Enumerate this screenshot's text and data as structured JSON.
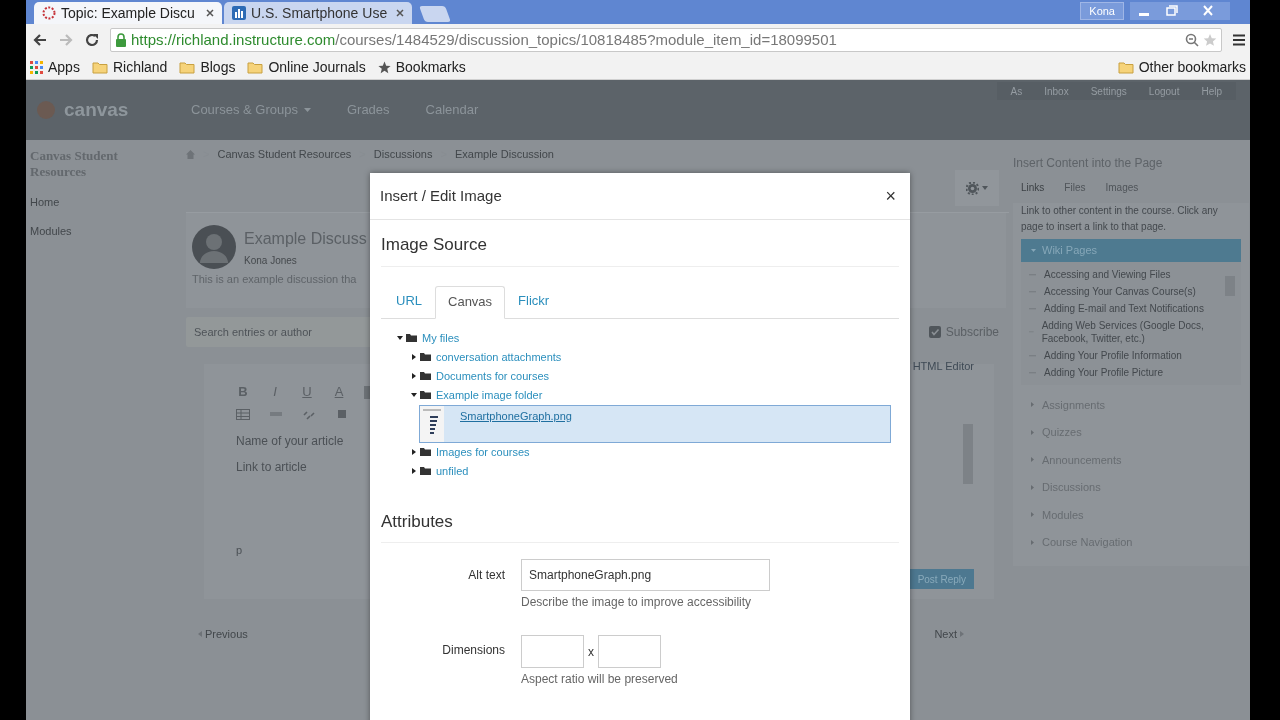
{
  "browser": {
    "tabs": [
      {
        "title": "Topic: Example Discu",
        "selected": true,
        "kind": "canvas"
      },
      {
        "title": "U.S. Smartphone Use",
        "selected": false,
        "kind": "chart"
      }
    ],
    "profile": "Kona",
    "url": {
      "host": "https://richland.instructure.com",
      "path": "/courses/1484529/discussion_topics/10818485?module_item_id=18099501"
    },
    "bookmarks": [
      {
        "label": "Apps",
        "kind": "apps"
      },
      {
        "label": "Richland",
        "kind": "folder"
      },
      {
        "label": "Blogs",
        "kind": "folder"
      },
      {
        "label": "Online Journals",
        "kind": "folder"
      },
      {
        "label": "Bookmarks",
        "kind": "star"
      }
    ],
    "other_bookmarks": "Other bookmarks"
  },
  "header": {
    "logo": "canvas",
    "nav": [
      "Courses & Groups",
      "Grades",
      "Calendar"
    ],
    "user_links": [
      "As",
      "Inbox",
      "Settings",
      "Logout",
      "Help"
    ]
  },
  "left_nav": {
    "course": "Canvas Student Resources",
    "items": [
      "Home",
      "Modules"
    ]
  },
  "breadcrumbs": [
    "Canvas Student Resources",
    "Discussions",
    "Example Discussion"
  ],
  "discussion": {
    "title": "Example Discuss",
    "author": "Kona Jones",
    "body": "This is an example discussion tha",
    "search_placeholder": "Search entries or author",
    "subscribe": "Subscribe",
    "html_editor": "HTML Editor",
    "editor_buttons": [
      "B",
      "I",
      "U",
      "A"
    ],
    "editor_lines": [
      "Name of your article",
      "Link to article"
    ],
    "editor_path": "p",
    "post_reply": "Post Reply",
    "previous": "Previous",
    "next": "Next"
  },
  "right_sidebar": {
    "title": "Insert Content into the Page",
    "tabs": [
      {
        "label": "Links",
        "selected": true
      },
      {
        "label": "Files",
        "selected": false
      },
      {
        "label": "Images",
        "selected": false
      }
    ],
    "hint": "Link to other content in the course. Click any page to insert a link to that page.",
    "sections": [
      {
        "label": "Wiki Pages",
        "expanded": true,
        "items": [
          "Accessing and Viewing Files",
          "Accessing Your Canvas Course(s)",
          "Adding E-mail and Text Notifications",
          "Adding Web Services (Google Docs, Facebook, Twitter, etc.)",
          "Adding Your Profile Information",
          "Adding Your Profile Picture"
        ]
      },
      {
        "label": "Assignments",
        "expanded": false
      },
      {
        "label": "Quizzes",
        "expanded": false
      },
      {
        "label": "Announcements",
        "expanded": false
      },
      {
        "label": "Discussions",
        "expanded": false
      },
      {
        "label": "Modules",
        "expanded": false
      },
      {
        "label": "Course Navigation",
        "expanded": false
      }
    ]
  },
  "dialog": {
    "title": "Insert / Edit Image",
    "close": "×",
    "section": "Image Source",
    "tabs": [
      {
        "label": "URL",
        "selected": false
      },
      {
        "label": "Canvas",
        "selected": true
      },
      {
        "label": "Flickr",
        "selected": false
      }
    ],
    "tree": [
      {
        "label": "My files",
        "kind": "folder",
        "expanded": true,
        "selected": false,
        "children": [
          {
            "label": "conversation attachments",
            "kind": "folder",
            "expanded": false,
            "selected": false
          },
          {
            "label": "Documents for courses",
            "kind": "folder",
            "expanded": false,
            "selected": false
          },
          {
            "label": "Example image folder",
            "kind": "folder",
            "expanded": true,
            "selected": false,
            "children": [
              {
                "label": "SmartphoneGraph.png",
                "kind": "file",
                "selected": true
              }
            ]
          },
          {
            "label": "Images for courses",
            "kind": "folder",
            "expanded": false,
            "selected": false
          },
          {
            "label": "unfiled",
            "kind": "folder",
            "expanded": false,
            "selected": false
          }
        ]
      }
    ],
    "attributes": "Attributes",
    "alt_label": "Alt text",
    "alt_value": "SmartphoneGraph.png",
    "alt_hint": "Describe the image to improve accessibility",
    "dimensions_label": "Dimensions",
    "dimensions_sep": "x",
    "dimensions_hint": "Aspect ratio will be preserved"
  }
}
